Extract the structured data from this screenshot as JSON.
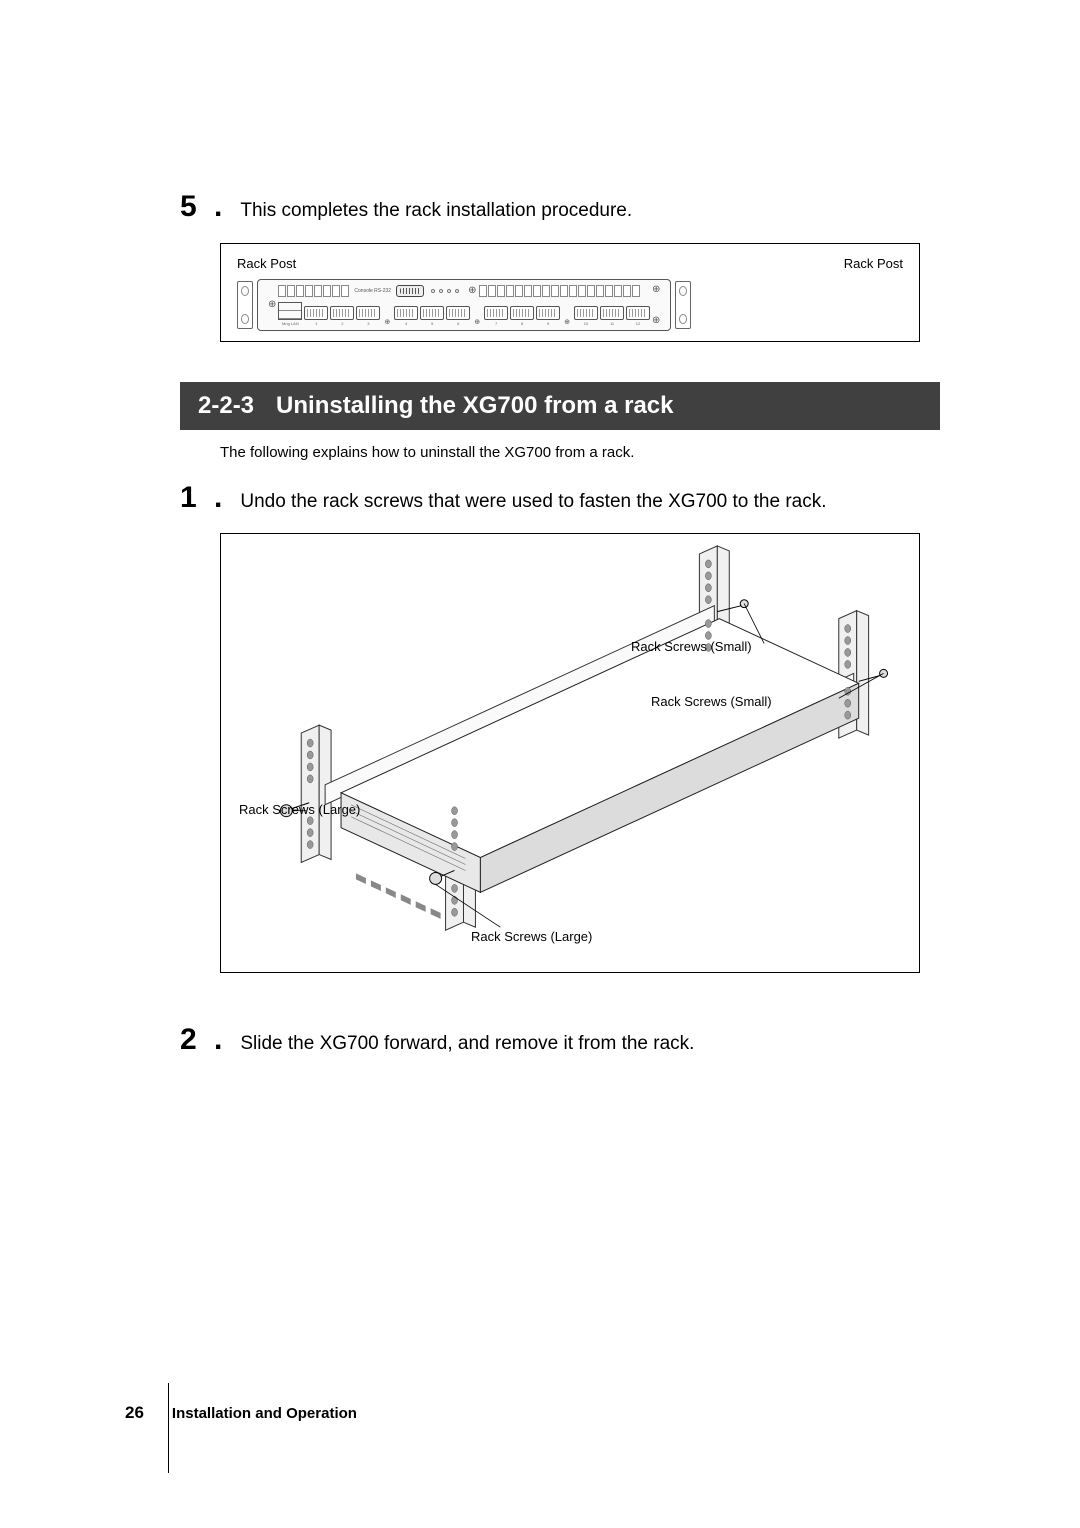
{
  "step5": {
    "num": "5",
    "dot": ".",
    "text": "This completes the rack installation procedure."
  },
  "fig1": {
    "leftLabel": "Rack Post",
    "rightLabel": "Rack Post",
    "consoleLabel": "Console RS-232",
    "mgmtLabel": "Mng LAN",
    "portNums": [
      "1",
      "2",
      "3",
      "4",
      "5",
      "6",
      "7",
      "8",
      "9",
      "10",
      "11",
      "12"
    ]
  },
  "section": {
    "num": "2-2-3",
    "title": "Uninstalling the XG700 from a rack",
    "intro": "The following explains how to uninstall the XG700 from a rack."
  },
  "step1": {
    "num": "1",
    "dot": ".",
    "text": "Undo the rack screws that were used to fasten the XG700 to the rack."
  },
  "fig2": {
    "lblSmall1": "Rack Screws (Small)",
    "lblSmall2": "Rack Screws (Small)",
    "lblLarge1": "Rack Screws (Large)",
    "lblLarge2": "Rack Screws (Large)"
  },
  "step2": {
    "num": "2",
    "dot": ".",
    "text": "Slide the XG700 forward, and remove it from the rack."
  },
  "footer": {
    "page": "26",
    "title": "Installation and Operation"
  }
}
